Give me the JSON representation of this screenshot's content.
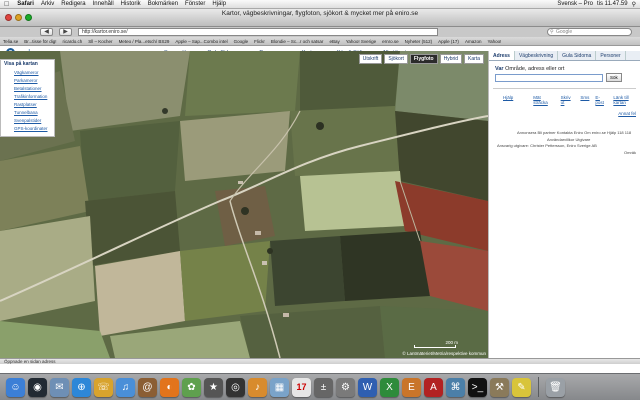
{
  "menubar": {
    "apple": "",
    "items": [
      "Safari",
      "Arkiv",
      "Redigera",
      "Innehåll",
      "Historik",
      "Bokmärken",
      "Fönster",
      "Hjälp"
    ],
    "right_lang": "Svensk – Pro",
    "right_clock": "tis 11.47.59"
  },
  "browser": {
    "title": "Kartor, vägbeskrivningar, flygfoton, sjökort & mycket mer på eniro.se",
    "url": "http://kartor.eniro.se/",
    "search_placeholder": "Google",
    "back": "◀",
    "forward": "▶",
    "bookmarks": [
      "Telia.se",
      "Br...tisse för dig!",
      "ricardo.ch",
      "Sll – Kocher",
      "Meteo / Pla...etsch/ BS29",
      "Apple – Sap...Combo intel",
      "Google",
      "Flickr",
      "Blondie – Sc...r och satsar",
      "eBay",
      "Yahoo! Sverige",
      "ernro.se",
      "Nyheter (512)",
      "Apple (17)",
      "Amazon",
      "Yahoo!"
    ]
  },
  "site": {
    "logo_mark": "e",
    "logo_text": "eniro",
    "nav": [
      "Supersök",
      "Gula Sidorna",
      "Personer",
      "Kartor",
      "Köp & Sälj",
      "Alla tjänster"
    ]
  },
  "map": {
    "tabs": [
      "Utskrift",
      "Sjökort",
      "Flygfoto",
      "Hybrid",
      "Karta"
    ],
    "active_tab": "Flygfoto",
    "legend_title": "Visa på kartan",
    "legend_items": [
      "Vägkameror",
      "Parkameror",
      "Betalstationer",
      "Trafikinformation",
      "Rastplatser",
      "Tunnelbana",
      "Svenpalstider",
      "GPS-koordinater"
    ],
    "scale_label": "200 m",
    "copyright": "© Lantmäteriet/Metria/respektive kommun"
  },
  "panel": {
    "tabs": [
      "Adress",
      "Vägbeskrivning",
      "Gula Sidorna",
      "Personer"
    ],
    "active_tab": "Adress",
    "query_bold": "Var",
    "query_rest": "Område, adress eller ort",
    "search_button": "Sök",
    "links_first": "Hjälp",
    "links": [
      "Mät sträcka",
      "Skriv ut",
      "Sms",
      "E-post",
      "Länk till kartan"
    ],
    "help_link": "Annat fel",
    "body_lines": [
      "Annonsera   Bli partner   Kontakta Eniro   Om eniro.se   Hjälp   118 118",
      "Användarvillkor   Utgivare",
      "Ansvarig utgivare: Christer Pettersson, Eniro Sverige AB",
      "Omräk"
    ]
  },
  "status": {
    "text": "Öppnade en sidan adress"
  },
  "dock": {
    "items": [
      {
        "icon": "finder-icon",
        "glyph": "☺",
        "color": "#3c7fd6"
      },
      {
        "icon": "dashboard-icon",
        "glyph": "◉",
        "color": "#222a33"
      },
      {
        "icon": "mail-icon",
        "glyph": "✉",
        "color": "#6e8fb5"
      },
      {
        "icon": "safari-icon",
        "glyph": "⊕",
        "color": "#2d87d8"
      },
      {
        "icon": "ichat-icon",
        "glyph": "☏",
        "color": "#d8a32d"
      },
      {
        "icon": "itunes-icon",
        "glyph": "♫",
        "color": "#4a8fd8"
      },
      {
        "icon": "address-book-icon",
        "glyph": "@",
        "color": "#8b5e34"
      },
      {
        "icon": "firefox-icon",
        "glyph": "◐",
        "color": "#e2741c"
      },
      {
        "icon": "photo-icon",
        "glyph": "✿",
        "color": "#5fa04e"
      },
      {
        "icon": "imovie-icon",
        "glyph": "★",
        "color": "#555"
      },
      {
        "icon": "idvd-icon",
        "glyph": "◎",
        "color": "#333"
      },
      {
        "icon": "garageband-icon",
        "glyph": "♪",
        "color": "#d88b2d"
      },
      {
        "icon": "preview-icon",
        "glyph": "▦",
        "color": "#7aa3c9"
      },
      {
        "icon": "ical-icon",
        "glyph": "17",
        "color": "#e6e6e6"
      },
      {
        "icon": "calculator-icon",
        "glyph": "±",
        "color": "#666"
      },
      {
        "icon": "preferences-icon",
        "glyph": "⚙",
        "color": "#7a7a7a"
      },
      {
        "icon": "word-icon",
        "glyph": "W",
        "color": "#2f5fb1"
      },
      {
        "icon": "excel-icon",
        "glyph": "X",
        "color": "#2e8b3b"
      },
      {
        "icon": "entourage-icon",
        "glyph": "E",
        "color": "#c9752a"
      },
      {
        "icon": "acrobat-icon",
        "glyph": "A",
        "color": "#b22222"
      },
      {
        "icon": "network-icon",
        "glyph": "⌘",
        "color": "#4b7fa8"
      },
      {
        "icon": "terminal-icon",
        "glyph": ">_",
        "color": "#111"
      },
      {
        "icon": "utility-icon",
        "glyph": "⚒",
        "color": "#8a7a5a"
      },
      {
        "icon": "stickies-icon",
        "glyph": "✎",
        "color": "#d8c43a"
      }
    ],
    "trash": {
      "icon": "trash-icon",
      "glyph": "🗑",
      "color": "#9aa0a6"
    }
  },
  "colors": {
    "accent": "#1d5aa5",
    "brand": "#1c5d9c"
  }
}
